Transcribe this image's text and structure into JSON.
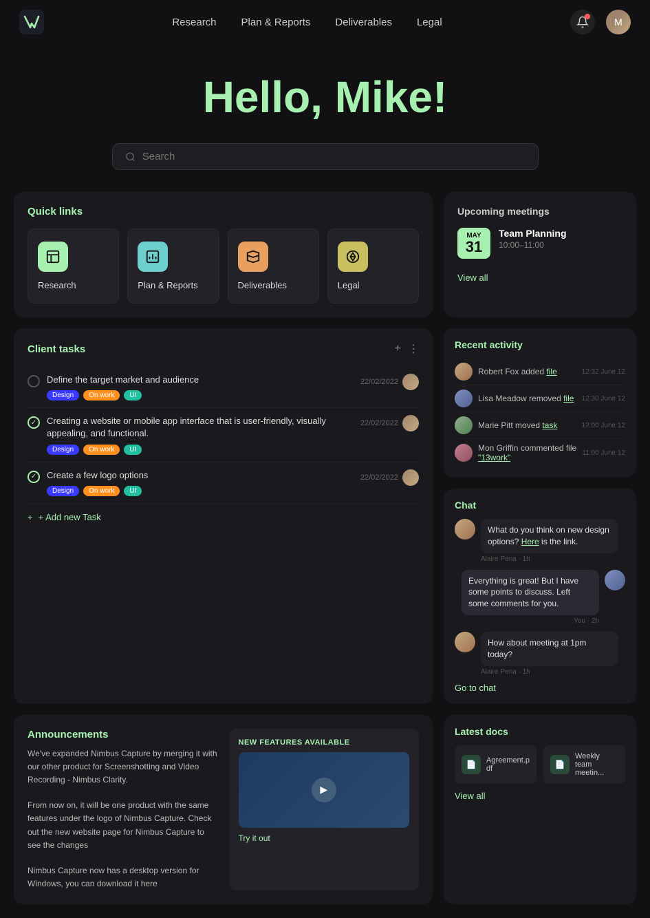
{
  "app": {
    "logo_text": "✦",
    "nav": {
      "links": [
        {
          "label": "Research",
          "id": "research"
        },
        {
          "label": "Plan & Reports",
          "id": "plan-reports"
        },
        {
          "label": "Deliverables",
          "id": "deliverables"
        },
        {
          "label": "Legal",
          "id": "legal"
        }
      ]
    }
  },
  "hero": {
    "greeting": "Hello, ",
    "name": "Mike!"
  },
  "search": {
    "placeholder": "Search"
  },
  "quick_links": {
    "title": "Quick links",
    "items": [
      {
        "label": "Research",
        "icon": "📋",
        "color": "ql-green"
      },
      {
        "label": "Plan & Reports",
        "icon": "📊",
        "color": "ql-teal"
      },
      {
        "label": "Deliverables",
        "icon": "📦",
        "color": "ql-orange"
      },
      {
        "label": "Legal",
        "icon": "⚖️",
        "color": "ql-yellow"
      }
    ]
  },
  "upcoming_meetings": {
    "title": "Upcoming meetings",
    "meeting": {
      "month": "May",
      "day": "31",
      "name": "Team Planning",
      "time": "10:00–11:00"
    },
    "view_all": "View all"
  },
  "client_tasks": {
    "title": "Client tasks",
    "add_label": "+ Add new Task",
    "tasks": [
      {
        "done": false,
        "text": "Define the target market and audience",
        "date": "22/02/2022",
        "tags": [
          "Design",
          "On work",
          "UI"
        ]
      },
      {
        "done": true,
        "text": "Creating a website or mobile app interface that is user-friendly, visually appealing, and functional.",
        "date": "22/02/2022",
        "tags": [
          "Design",
          "On work",
          "UI"
        ]
      },
      {
        "done": true,
        "text": "Create a few logo options",
        "date": "22/02/2022",
        "tags": [
          "Design",
          "On work",
          "UI"
        ]
      }
    ]
  },
  "recent_activity": {
    "title": "Recent activity",
    "items": [
      {
        "user": "Robert Fox",
        "action": "added",
        "item": "file",
        "time": "12:32 June 12"
      },
      {
        "user": "Lisa Meadow",
        "action": "removed",
        "item": "file",
        "time": "12:30 June 12"
      },
      {
        "user": "Marie Pitt",
        "action": "moved",
        "item": "task",
        "time": "12:00 June 12"
      },
      {
        "user": "Mon Griffin",
        "action": "commented file",
        "item": "\"13work\"",
        "time": "11:00 June 12"
      }
    ]
  },
  "chat": {
    "title": "Chat",
    "messages": [
      {
        "sender": "Alaire Pena",
        "time": "1h",
        "text_before": "What do you think on new design options? ",
        "link_text": "Here",
        "text_after": " is the link.",
        "is_self": false
      },
      {
        "sender": "You",
        "time": "2h",
        "text": "Everything is great! But I have some points to discuss. Left some comments for you.",
        "is_self": true
      },
      {
        "sender": "Alaire Pena",
        "time": "1h",
        "text": "How about meeting at 1pm today?",
        "is_self": false
      }
    ],
    "goto_label": "Go to chat"
  },
  "announcements": {
    "title": "Announcements",
    "text1": "We've expanded Nimbus Capture by merging it with our other product for Screenshotting and Video Recording - Nimbus Clarity.",
    "text2": "From now on, it will be one product with the same features under the logo of Nimbus Capture. Check out the new website page for Nimbus Capture to see the changes",
    "text3": "Nimbus Capture now has a desktop version for Windows, you can download it here",
    "feature_label": "NEW FEATURES AVAILABLE",
    "try_it": "Try it out"
  },
  "latest_docs": {
    "title": "Latest docs",
    "docs": [
      {
        "name": "Agreement.pdf"
      },
      {
        "name": "Weekly team meetin..."
      }
    ],
    "view_all": "View all"
  }
}
